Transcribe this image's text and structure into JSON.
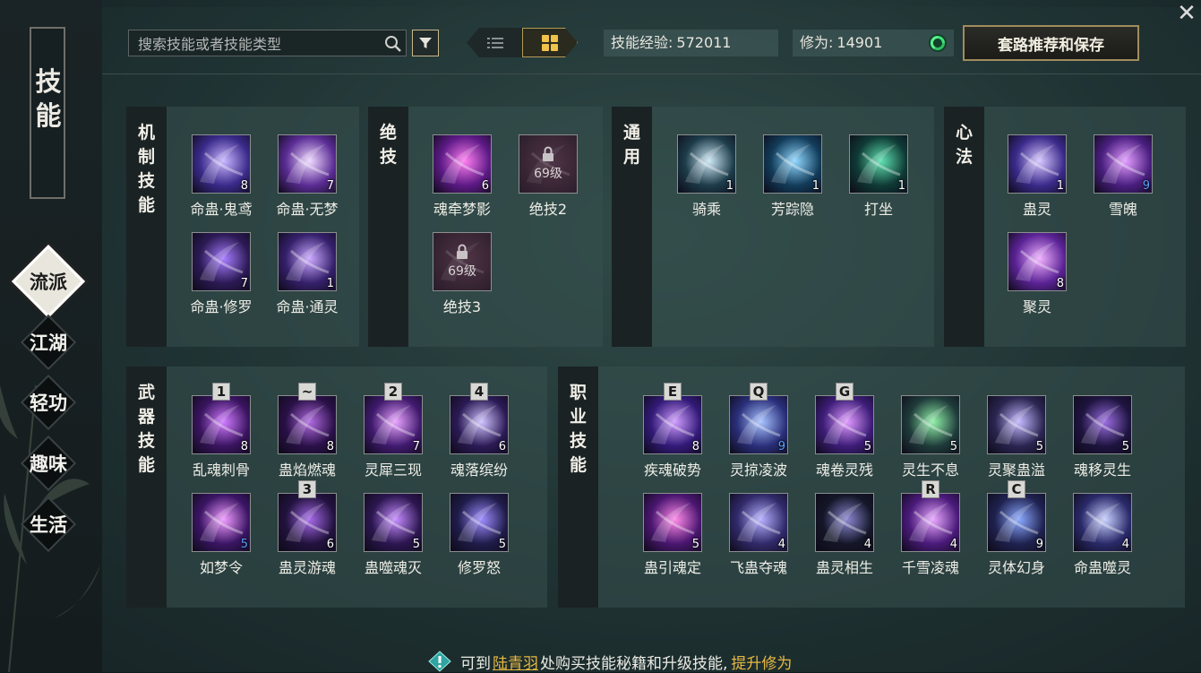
{
  "sidebar": {
    "title": "技能",
    "nav": [
      "流派",
      "江湖",
      "轻功",
      "趣味",
      "生活"
    ],
    "active_index": 0
  },
  "toolbar": {
    "search_placeholder": "搜索技能或者技能类型",
    "skill_exp_label": "技能经验:",
    "skill_exp_value": "572011",
    "cultivation_label": "修为:",
    "cultivation_value": "14901",
    "recommend_button": "套路推荐和保存"
  },
  "panels": {
    "mechanism": {
      "title": "机制技能",
      "skills": [
        {
          "name": "命蛊·鬼鸢",
          "level": "8",
          "c1": "#3a2a8a",
          "c2": "#c9b6ff"
        },
        {
          "name": "命蛊·无梦",
          "level": "7",
          "c1": "#5a2c94",
          "c2": "#efd9ff"
        },
        {
          "name": "命蛊·修罗",
          "level": "7",
          "c1": "#2c1a55",
          "c2": "#a77cff"
        },
        {
          "name": "命蛊·通灵",
          "level": "1",
          "c1": "#35206b",
          "c2": "#caa8ff"
        }
      ]
    },
    "ultimate": {
      "title": "绝技",
      "skills": [
        {
          "name": "魂牵梦影",
          "level": "6",
          "locked": false,
          "c1": "#5d1a86",
          "c2": "#ff7df0"
        },
        {
          "name": "绝技2",
          "level": "",
          "locked": true,
          "lock_label": "69级",
          "c1": "#3a2634",
          "c2": "#6d4a60"
        },
        {
          "name": "绝技3",
          "level": "",
          "locked": true,
          "lock_label": "69级",
          "c1": "#3a2634",
          "c2": "#6d4a60"
        }
      ]
    },
    "general": {
      "title": "通用",
      "skills": [
        {
          "name": "骑乘",
          "level": "1",
          "c1": "#1d3c4a",
          "c2": "#cde7f5"
        },
        {
          "name": "芳踪隐",
          "level": "1",
          "c1": "#123c5a",
          "c2": "#8fd7ff"
        },
        {
          "name": "打坐",
          "level": "1",
          "c1": "#0f3a35",
          "c2": "#5fe0b0"
        }
      ]
    },
    "mind": {
      "title": "心法",
      "skills": [
        {
          "name": "蛊灵",
          "level": "1",
          "c1": "#3a2a8a",
          "c2": "#d6c6ff"
        },
        {
          "name": "雪魄",
          "level": "9",
          "level_color": "blue",
          "c1": "#4a1f80",
          "c2": "#e39cff"
        },
        {
          "name": "聚灵",
          "level": "8",
          "c1": "#5b2396",
          "c2": "#f0b0ff"
        }
      ]
    },
    "weapon": {
      "title": "武器技能",
      "skills": [
        {
          "name": "乱魂刺骨",
          "level": "8",
          "key": "1",
          "c1": "#3a1460",
          "c2": "#d07aff"
        },
        {
          "name": "蛊焰燃魂",
          "level": "8",
          "key": "~",
          "c1": "#2a1048",
          "c2": "#b06ae0"
        },
        {
          "name": "灵犀三现",
          "level": "7",
          "key": "2",
          "c1": "#401a6e",
          "c2": "#e8a2ff"
        },
        {
          "name": "魂落缤纷",
          "level": "6",
          "key": "4",
          "c1": "#2b1a55",
          "c2": "#d0c2ff"
        },
        {
          "name": "如梦令",
          "level": "5",
          "key": "",
          "level_color": "blue",
          "c1": "#3b1565",
          "c2": "#f09bff"
        },
        {
          "name": "蛊灵游魂",
          "level": "6",
          "key": "3",
          "c1": "#22123e",
          "c2": "#a468e8"
        },
        {
          "name": "蛊噬魂灭",
          "level": "5",
          "key": "",
          "c1": "#2c1650",
          "c2": "#c58cff"
        },
        {
          "name": "修罗怒",
          "level": "5",
          "key": "",
          "c1": "#1f1c4a",
          "c2": "#9c8cff"
        }
      ]
    },
    "profession": {
      "title": "职业技能",
      "skills": [
        {
          "name": "疾魂破势",
          "level": "8",
          "key": "E",
          "c1": "#321a78",
          "c2": "#cf9bff"
        },
        {
          "name": "灵掠凌波",
          "level": "9",
          "key": "Q",
          "level_color": "blue",
          "c1": "#2a2f7a",
          "c2": "#a8c3ff"
        },
        {
          "name": "魂卷灵残",
          "level": "5",
          "key": "G",
          "c1": "#3d1d78",
          "c2": "#e09aff"
        },
        {
          "name": "灵生不息",
          "level": "5",
          "key": "",
          "c1": "#1f3b3a",
          "c2": "#8ff0a8"
        },
        {
          "name": "灵聚蛊溢",
          "level": "5",
          "key": "",
          "c1": "#2a2550",
          "c2": "#c4b8ff"
        },
        {
          "name": "魂移灵生",
          "level": "5",
          "key": "",
          "c1": "#1e1440",
          "c2": "#9a6ce0"
        },
        {
          "name": "蛊引魂定",
          "level": "5",
          "key": "",
          "c1": "#4a1670",
          "c2": "#ff8ae8"
        },
        {
          "name": "飞蛊夺魂",
          "level": "4",
          "key": "",
          "c1": "#302a6a",
          "c2": "#b6b0ff"
        },
        {
          "name": "蛊灵相生",
          "level": "4",
          "key": "",
          "c1": "#141628",
          "c2": "#8a86d0"
        },
        {
          "name": "千雪凌魂",
          "level": "4",
          "key": "R",
          "c1": "#4a1a7a",
          "c2": "#e8a8ff"
        },
        {
          "name": "灵体幻身",
          "level": "9",
          "key": "C",
          "c1": "#1f2250",
          "c2": "#8aa8ff"
        },
        {
          "name": "命蛊噬灵",
          "level": "4",
          "key": "",
          "c1": "#2a2a6a",
          "c2": "#c8d0ff"
        }
      ]
    }
  },
  "footer": {
    "prefix": "可到",
    "npc": "陆青羽",
    "middle": "处购买技能秘籍和升级技能,",
    "link": "提升修为"
  }
}
